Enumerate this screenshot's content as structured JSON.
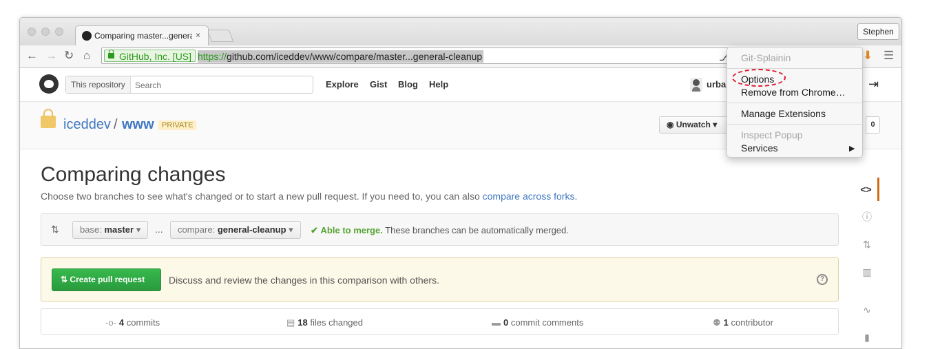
{
  "browser": {
    "tab_title": "Comparing master...general-cleanup",
    "tab_close": "×",
    "user_button": "Stephen",
    "ev_label": "GitHub, Inc. [US]",
    "url_scheme": "https://",
    "url_rest": "github.com/iceddev/www/compare/master...general-cleanup",
    "nav_back": "←",
    "nav_forward": "→",
    "nav_reload": "↻",
    "nav_home": "⌂",
    "download_icon": "⬇",
    "menu_icon": "☰"
  },
  "github": {
    "search_scope": "This repository",
    "search_placeholder": "Search",
    "nav": [
      "Explore",
      "Gist",
      "Blog",
      "Help"
    ],
    "username": "urban"
  },
  "repo": {
    "owner": "iceddev",
    "separator": "/",
    "name": "www",
    "badge": "PRIVATE",
    "unwatch_label": "Unwatch",
    "count": "0"
  },
  "compare": {
    "title": "Comparing changes",
    "subtitle": "Choose two branches to see what's changed or to start a new pull request. If you need to, you can also",
    "subtitle_link": "compare across forks",
    "subtitle_end": ".",
    "base_prefix": "base:",
    "base_branch": "master",
    "ellipsis": "...",
    "compare_prefix": "compare:",
    "compare_branch": "general-cleanup",
    "merge_ok": "Able to merge.",
    "merge_text": "These branches can be automatically merged.",
    "create_button": "Create pull request",
    "flash_text": "Discuss and review the changes in this comparison with others.",
    "stats": [
      {
        "count": "4",
        "label": "commits"
      },
      {
        "count": "18",
        "label": "files changed"
      },
      {
        "count": "0",
        "label": "commit comments"
      },
      {
        "count": "1",
        "label": "contributor"
      }
    ]
  },
  "context_menu": {
    "header": "Git-Splainin",
    "items": [
      "Options",
      "Remove from Chrome…",
      "Manage Extensions",
      "Inspect Popup",
      "Services"
    ]
  },
  "colors": {
    "accent_link": "#4078c0",
    "success_green": "#55a532",
    "highlight_red": "#e0162b"
  }
}
